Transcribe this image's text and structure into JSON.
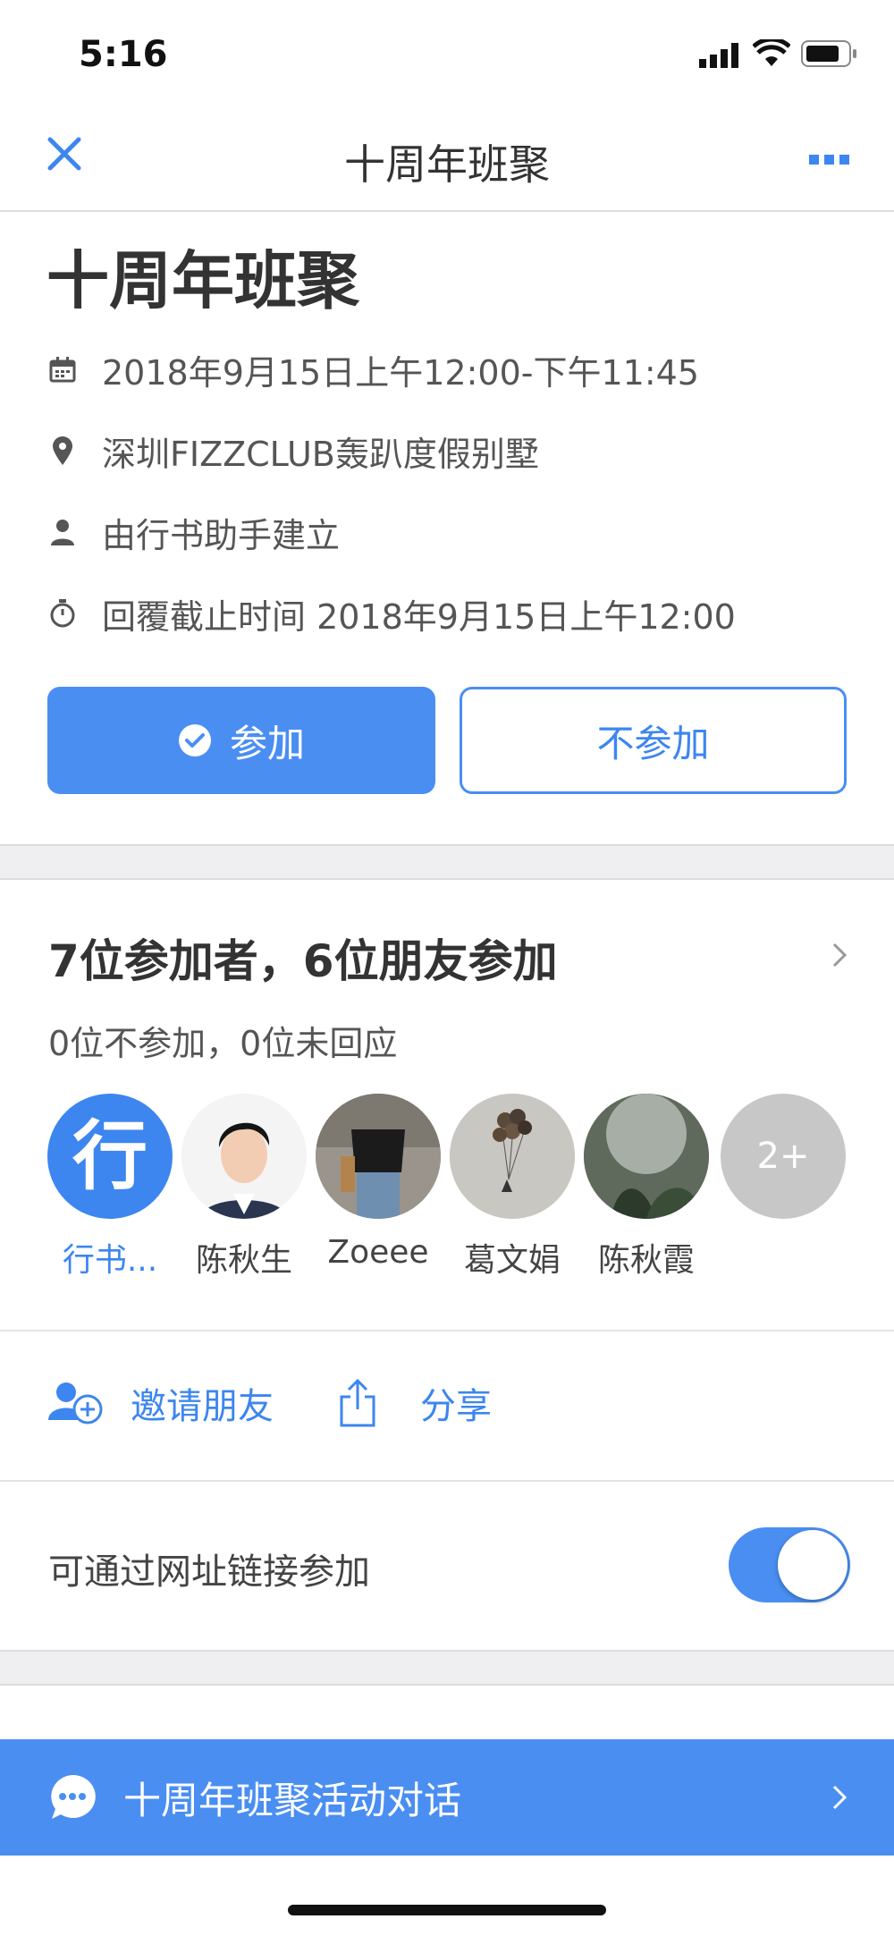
{
  "status_bar": {
    "time": "5:16"
  },
  "nav": {
    "title": "十周年班聚"
  },
  "event": {
    "title": "十周年班聚",
    "datetime": "2018年9月15日上午12:00-下午11:45",
    "location": "深圳FIZZCLUB轰趴度假别墅",
    "creator": "由行书助手建立",
    "deadline": "回覆截止时间 2018年9月15日上午12:00"
  },
  "rsvp": {
    "join_label": "参加",
    "decline_label": "不参加"
  },
  "attendees": {
    "title": "7位参加者，6位朋友参加",
    "subtitle": "0位不参加，0位未回应",
    "people": [
      {
        "label": "行书...",
        "avatar_text": "行"
      },
      {
        "label": "陈秋生"
      },
      {
        "label": "Zoeee"
      },
      {
        "label": "葛文娟"
      },
      {
        "label": "陈秋霞"
      }
    ],
    "more_label": "2+"
  },
  "actions": {
    "invite_label": "邀请朋友",
    "share_label": "分享"
  },
  "link_join": {
    "label": "可通过网址链接参加",
    "enabled": true
  },
  "chat_bar": {
    "label": "十周年班聚活动对话"
  },
  "colors": {
    "accent": "#4a8ef2",
    "gap": "#efeff2"
  }
}
